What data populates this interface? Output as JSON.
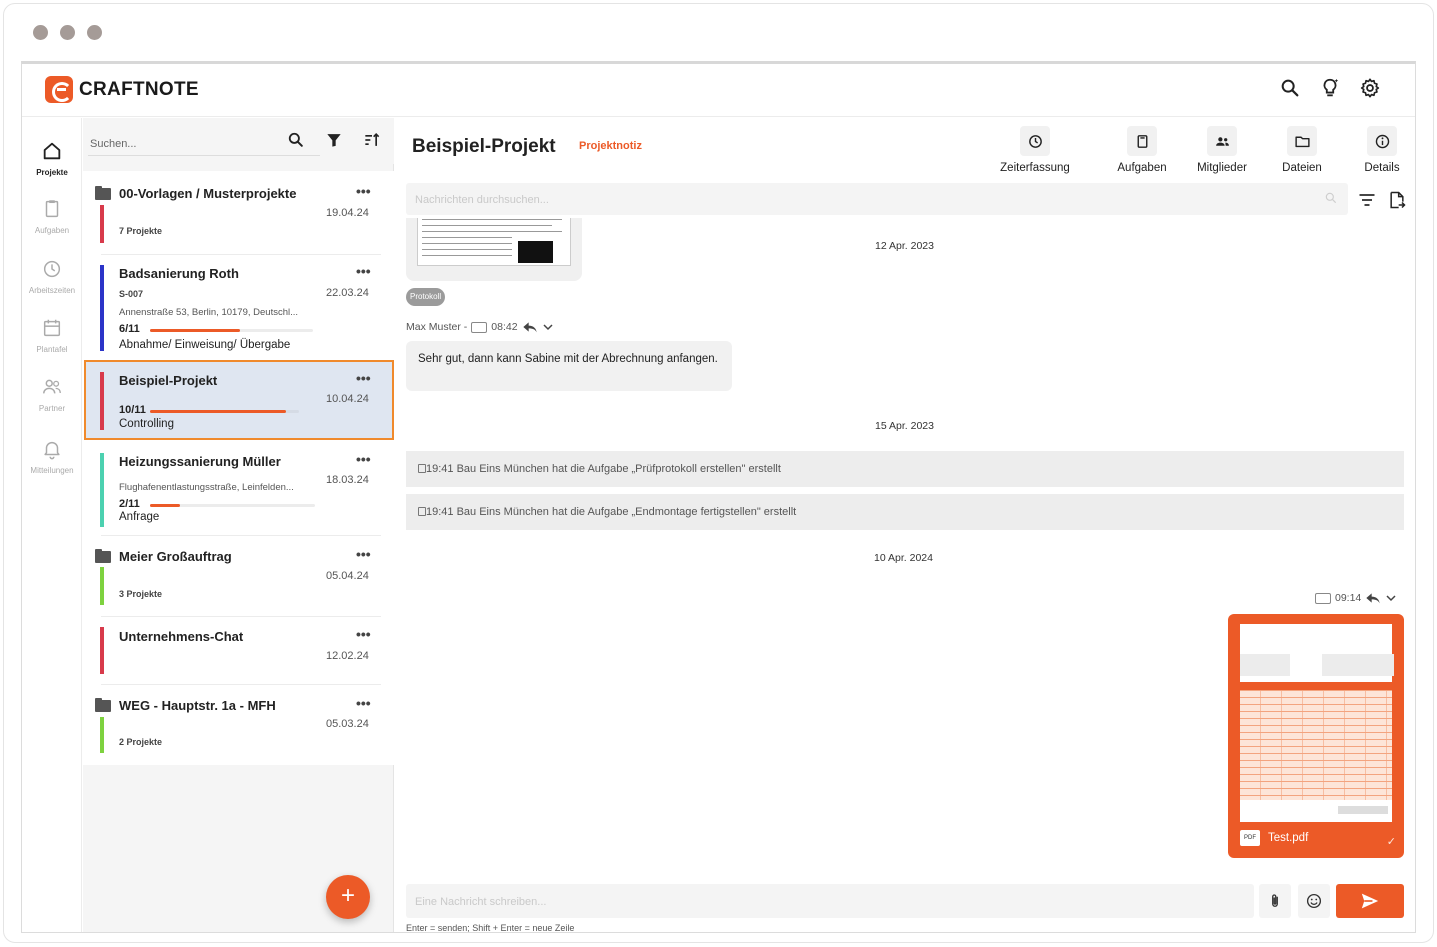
{
  "app": {
    "name": "CRAFTNOTE",
    "accent": "#ec5a27"
  },
  "topbar": {
    "icons": [
      "search-icon",
      "lightbulb-icon",
      "gear-icon"
    ]
  },
  "rail": {
    "items": [
      {
        "label": "Projekte",
        "icon": "home-icon",
        "active": true
      },
      {
        "label": "Aufgaben",
        "icon": "clipboard-icon"
      },
      {
        "label": "Arbeitszeiten",
        "icon": "clock-icon"
      },
      {
        "label": "Plantafel",
        "icon": "calendar-icon"
      },
      {
        "label": "Partner",
        "icon": "people-icon"
      },
      {
        "label": "Mitteilungen",
        "icon": "bell-icon"
      }
    ]
  },
  "list": {
    "search_placeholder": "Suchen...",
    "projects": [
      {
        "name": "00-Vorlagen / Musterprojekte",
        "date": "19.04.24",
        "sub": "7 Projekte",
        "folder": true,
        "color": "#d83a4b"
      },
      {
        "name": "Badsanierung Roth",
        "date": "22.03.24",
        "sub": "S-007",
        "address": "Annenstraße 53, Berlin, 10179, Deutschl...",
        "progress_label": "6/11",
        "progress": 0.55,
        "phase": "Abnahme/ Einweisung/ Übergabe",
        "color": "#2b34c8"
      },
      {
        "name": "Beispiel-Projekt",
        "date": "10.04.24",
        "progress_label": "10/11",
        "progress": 0.91,
        "phase": "Controlling",
        "color": "#d83a4b",
        "selected": true
      },
      {
        "name": "Heizungssanierung Müller",
        "date": "18.03.24",
        "address": "Flughafenentlastungsstraße, Leinfelden...",
        "progress_label": "2/11",
        "progress": 0.18,
        "phase": "Anfrage",
        "color": "#4cd1b0"
      },
      {
        "name": "Meier Großauftrag",
        "date": "05.04.24",
        "sub": "3 Projekte",
        "folder": true,
        "color": "#7ed23f"
      },
      {
        "name": "Unternehmens-Chat",
        "date": "12.02.24",
        "color": "#d83a4b"
      },
      {
        "name": "WEG - Hauptstr. 1a - MFH",
        "date": "05.03.24",
        "sub": "2 Projekte",
        "folder": true,
        "color": "#7ed23f"
      }
    ],
    "fab_label": "+"
  },
  "main": {
    "title": "Beispiel-Projekt",
    "badge": "Projektnotiz",
    "tabs": [
      {
        "label": "Zeiterfassung",
        "icon": "clock-icon"
      },
      {
        "label": "Aufgaben",
        "icon": "clipboard-icon"
      },
      {
        "label": "Mitglieder",
        "icon": "people-icon"
      },
      {
        "label": "Dateien",
        "icon": "folder-icon"
      },
      {
        "label": "Details",
        "icon": "info-icon"
      }
    ],
    "search_placeholder": "Nachrichten durchsuchen...",
    "messages": {
      "pill": "Protokoll",
      "day1": "12 Apr. 2023",
      "sender": "Max Muster -",
      "time1": "08:42",
      "text1": "Sehr gut, dann kann Sabine mit der Abrechnung anfangen.",
      "day2": "15 Apr. 2023",
      "sys1": "19:41 Bau Eins München hat die Aufgabe „Prüfprotokoll erstellen\" erstellt",
      "sys2": "19:41 Bau Eins München hat die Aufgabe „Endmontage fertigstellen\" erstellt",
      "day3": "10 Apr. 2024",
      "time2": "09:14",
      "file_type": "PDF",
      "file_name": "Test.pdf",
      "check": "✓"
    },
    "composer_placeholder": "Eine Nachricht schreiben...",
    "hint": "Enter = senden; Shift + Enter = neue Zeile"
  }
}
